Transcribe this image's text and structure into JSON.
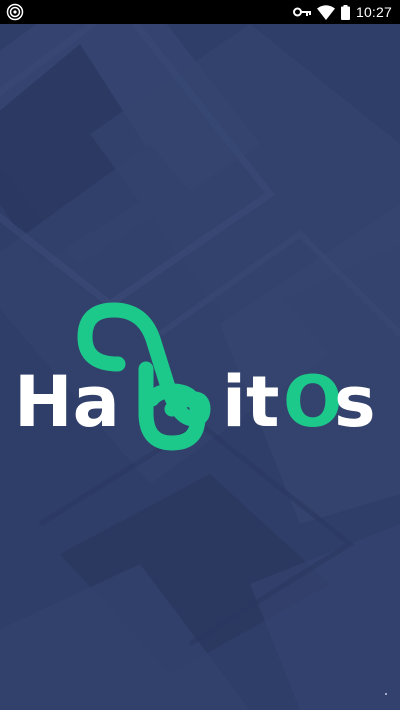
{
  "status_bar": {
    "time": "10:27",
    "icons": [
      "hotspot-icon",
      "vpn-key-icon",
      "wifi-icon",
      "battery-icon"
    ]
  },
  "app": {
    "logo_text_part1": "Ha",
    "logo_text_part2": "it",
    "logo_text_part3": "O",
    "logo_text_part4": "s",
    "brand_color": "#1cc98a",
    "background_color": "#2f3d69",
    "text_color": "#ffffff"
  }
}
